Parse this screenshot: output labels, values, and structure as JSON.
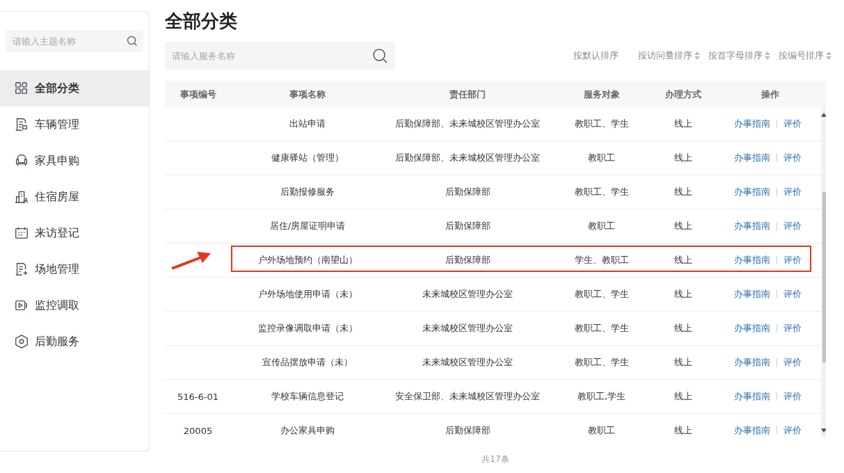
{
  "sidebar": {
    "search": {
      "placeholder": "请输入主题名称"
    },
    "items": [
      {
        "label": "全部分类",
        "selected": true
      },
      {
        "label": "车辆管理",
        "selected": false
      },
      {
        "label": "家具申购",
        "selected": false
      },
      {
        "label": "住宿房屋",
        "selected": false
      },
      {
        "label": "来访登记",
        "selected": false
      },
      {
        "label": "场地管理",
        "selected": false
      },
      {
        "label": "监控调取",
        "selected": false
      },
      {
        "label": "后勤服务",
        "selected": false
      }
    ]
  },
  "title": "全部分类",
  "search": {
    "placeholder": "请输入服务名称"
  },
  "sort_options": [
    {
      "label": "按默认排序",
      "kind": "plain"
    },
    {
      "label": "按访问量排序",
      "kind": "sortable"
    },
    {
      "label": "按首字母排序",
      "kind": "sortable"
    },
    {
      "label": "按编号排序",
      "kind": "sortable"
    }
  ],
  "table": {
    "columns": [
      "事项编号",
      "事项名称",
      "责任部门",
      "服务对象",
      "办理方式",
      "操作"
    ],
    "rows": [
      {
        "number": "",
        "name": "出站申请",
        "department": "后勤保障部、未来城校区管理办公室",
        "target": "教职工、学生",
        "method": "线上",
        "actions": [
          "办事指南",
          "评价"
        ],
        "highlighted": false
      },
      {
        "number": "",
        "name": "健康驿站（管理）",
        "department": "后勤保障部、未来城校区管理办公室",
        "target": "教职工",
        "method": "线上",
        "actions": [
          "办事指南",
          "评价"
        ],
        "highlighted": false
      },
      {
        "number": "",
        "name": "后勤报修服务",
        "department": "后勤保障部",
        "target": "教职工、学生",
        "method": "线上",
        "actions": [
          "办事指南",
          "评价"
        ],
        "highlighted": false
      },
      {
        "number": "",
        "name": "居住/房屋证明申请",
        "department": "后勤保障部",
        "target": "教职工",
        "method": "线上",
        "actions": [
          "办事指南",
          "评价"
        ],
        "highlighted": false
      },
      {
        "number": "",
        "name": "户外场地预约（南望山）",
        "department": "后勤保障部",
        "target": "学生、教职工",
        "method": "线上",
        "actions": [
          "办事指南",
          "评价"
        ],
        "highlighted": true
      },
      {
        "number": "",
        "name": "户外场地使用申请（未）",
        "department": "未来城校区管理办公室",
        "target": "教职工、学生",
        "method": "线上",
        "actions": [
          "办事指南",
          "评价"
        ],
        "highlighted": false
      },
      {
        "number": "",
        "name": "监控录像调取申请（未）",
        "department": "未来城校区管理办公室",
        "target": "教职工、学生",
        "method": "线上",
        "actions": [
          "办事指南",
          "评价"
        ],
        "highlighted": false
      },
      {
        "number": "",
        "name": "宣传品摆放申请（未）",
        "department": "未来城校区管理办公室",
        "target": "教职工、学生",
        "method": "线上",
        "actions": [
          "办事指南",
          "评价"
        ],
        "highlighted": false
      },
      {
        "number": "516-6-01",
        "name": "学校车辆信息登记",
        "department": "安全保卫部、未来城校区管理办公室",
        "target": "教职工,学生",
        "method": "线上",
        "actions": [
          "办事指南",
          "评价"
        ],
        "highlighted": false
      },
      {
        "number": "20005",
        "name": "办公家具申购",
        "department": "后勤保障部",
        "target": "教职工",
        "method": "线上",
        "actions": [
          "办事指南",
          "评价"
        ],
        "highlighted": false
      }
    ]
  },
  "total": "共17条"
}
